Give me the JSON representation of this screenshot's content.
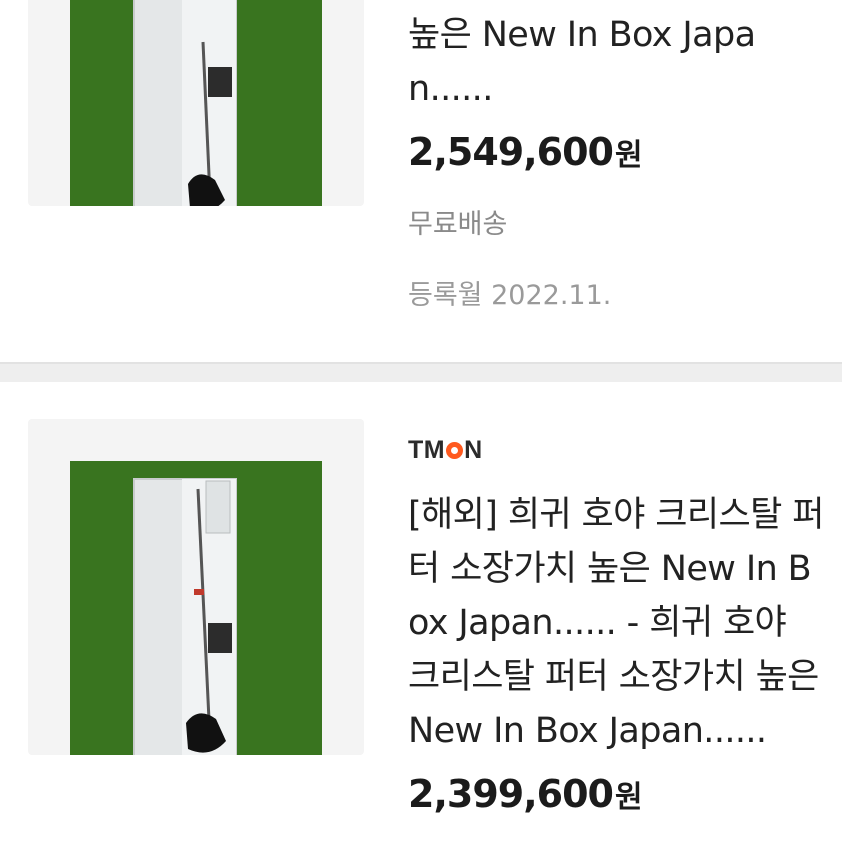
{
  "listings": [
    {
      "title": "호야 크리스탈 퍼터 소장가치 높은 New In Box Japan......",
      "price": "2,549,600",
      "currency": "원",
      "shipping": "무료배송",
      "registered": "등록월 2022.11."
    },
    {
      "store_logo_prefix": "TM",
      "store_logo_suffix": "N",
      "title": "[해외] 희귀 호야 크리스탈 퍼터 소장가치 높은 New In Box Japan...... - 희귀 호야 크리스탈 퍼터 소장가치 높은 New In Box Japan......",
      "price": "2,399,600",
      "currency": "원"
    }
  ],
  "colors": {
    "store_logo_accent": "#ff5a1f",
    "divider": "#eeeeee"
  }
}
